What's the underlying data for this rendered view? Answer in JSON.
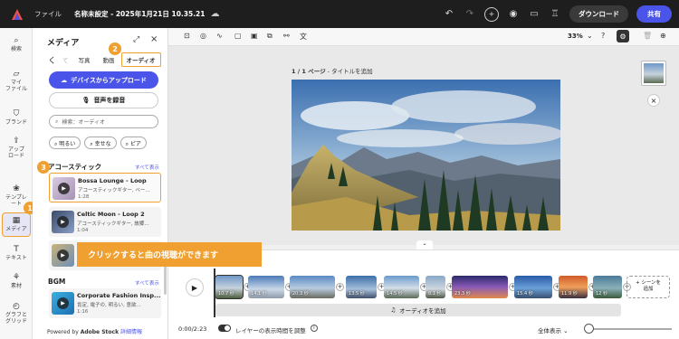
{
  "topbar": {
    "file": "ファイル",
    "title": "名称未設定 - 2025年1月21日 10.35.21",
    "download": "ダウンロード",
    "share": "共有"
  },
  "rail": [
    {
      "label": "検索",
      "icon": "search-icon"
    },
    {
      "label": "マイ\nファイル",
      "icon": "folder-icon"
    },
    {
      "label": "ブランド",
      "icon": "brand-icon"
    },
    {
      "label": "アップ\nロード",
      "icon": "upload-icon"
    },
    {
      "label": "テンプレ\nート",
      "icon": "template-icon"
    },
    {
      "label": "メディア",
      "icon": "media-icon"
    },
    {
      "label": "テキスト",
      "icon": "text-icon"
    },
    {
      "label": "素材",
      "icon": "elements-icon"
    },
    {
      "label": "グラフと\nグリッド",
      "icon": "grid-icon"
    }
  ],
  "panel": {
    "title": "メディア",
    "tabs": {
      "back": "く",
      "dim": "て",
      "photo": "写真",
      "video": "動画",
      "audio": "オーディオ"
    },
    "upload": "デバイスからアップロード",
    "record": "音声を録音",
    "search_placeholder": "検索：オーディオ",
    "chips": [
      "明るい",
      "幸せな",
      "ピア"
    ],
    "acoustic": {
      "heading": "アコースティック",
      "see_all": "すべて表示",
      "tracks": [
        {
          "name": "Bossa Lounge - Loop",
          "desc": "アコースティックギター, ベー...",
          "dur": "1:28"
        },
        {
          "name": "Celtic Moon - Loop 2",
          "desc": "アコースティックギター, 故郷...",
          "dur": "1:04"
        },
        {
          "name": "",
          "desc": "",
          "dur": ""
        }
      ]
    },
    "bgm": {
      "heading": "BGM",
      "see_all": "すべて表示",
      "tracks": [
        {
          "name": "Corporate Fashion Insp...",
          "desc": "肯定, 電子の, 明るい, 意欲...",
          "dur": "1:16"
        }
      ]
    },
    "powered_prefix": "Powered by ",
    "powered_brand": "Adobe Stock",
    "powered_link": "詳細情報"
  },
  "badges": [
    "1",
    "2",
    "3"
  ],
  "toolbar": {
    "zoom": "33%"
  },
  "canvas": {
    "page": "1 / 1 ページ",
    "page_title": " - タイトルを追加"
  },
  "tooltip": "クリックすると曲の視聴ができます",
  "timeline": {
    "clips": [
      {
        "dur": "10.7 秒"
      },
      {
        "dur": "14.1 秒"
      },
      {
        "dur": "20.3 秒"
      },
      {
        "dur": "13.5 秒"
      },
      {
        "dur": "14.5 秒"
      },
      {
        "dur": "8.1 秒"
      },
      {
        "dur": "23.3 秒"
      },
      {
        "dur": "15.4 秒"
      },
      {
        "dur": "11.9 秒"
      },
      {
        "dur": "12 秒"
      }
    ],
    "add_scene": "シーンを\n追加",
    "add_audio": "オーディオを追加",
    "time": "0:00/2:23",
    "toggle_label": "レイヤーの表示時間を調整",
    "view": "全体表示"
  }
}
